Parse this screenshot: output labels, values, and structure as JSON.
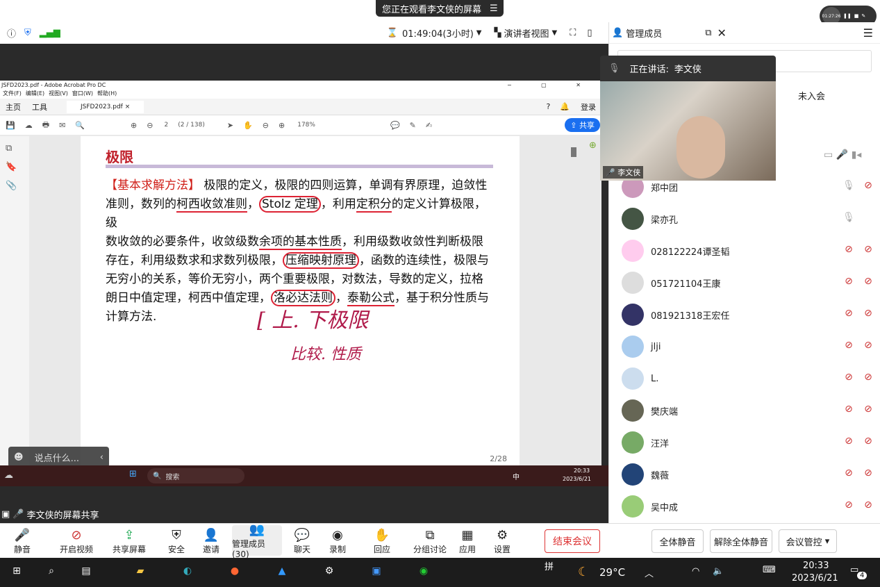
{
  "top": {
    "banner": "您正在观看李文侠的屏幕",
    "timer": "01:27:26"
  },
  "toolbar": {
    "duration": "01:49:04(3小时)",
    "view": "演讲者视图"
  },
  "panel": {
    "title": "管理成员",
    "not_joined": "未入会",
    "speaking_label": "正在讲话:",
    "speaking_name": "李文侠",
    "video_name": "李文侠",
    "members": [
      {
        "name": "郑中团",
        "mic": "on"
      },
      {
        "name": "梁亦孔",
        "mic": "on"
      },
      {
        "name": "028122224谭圣韬",
        "mic": "off"
      },
      {
        "name": "051721104王康",
        "mic": "off"
      },
      {
        "name": "081921318王宏任",
        "mic": "off"
      },
      {
        "name": "jlji",
        "mic": "off"
      },
      {
        "name": "L.",
        "mic": "off"
      },
      {
        "name": "樊庆端",
        "mic": "off"
      },
      {
        "name": "汪洋",
        "mic": "off"
      },
      {
        "name": "魏薇",
        "mic": "off"
      },
      {
        "name": "吴中成",
        "mic": "off"
      }
    ],
    "mute_all": "全体静音",
    "unmute_all": "解除全体静音",
    "control": "会议管控"
  },
  "acrobat": {
    "title": "JSFD2023.pdf - Adobe Acrobat Pro DC",
    "menu": [
      "文件(F)",
      "编辑(E)",
      "视图(V)",
      "窗口(W)",
      "帮助(H)"
    ],
    "tab_home": "主页",
    "tab_tools": "工具",
    "file_tab": "JSFD2023.pdf",
    "page": "2",
    "page_total": "(2 / 138)",
    "zoom": "178%",
    "share": "共享",
    "login": "登录",
    "page_indicator": "2/28"
  },
  "doc": {
    "heading": "极限",
    "tag": "【基本求解方法】",
    "l1": "极限的定义，极限的四则运算，单调有界原理，迫敛性",
    "l2a": "准则，数列的",
    "l2b": "柯西收敛准则",
    "l2c": "，",
    "l2d": "Stolz 定理",
    "l2e": "，利用",
    "l2f": "定积分",
    "l2g": "的定义计算极限，级",
    "l3a": "数收敛的必要条件，收敛级数",
    "l3b": "余项的基本性质",
    "l3c": "，利用级数收敛性判断极限",
    "l4a": "存在，利用级数求和求数列极限，",
    "l4b": "压缩映射原理",
    "l4c": "，函数的连续性，极限与",
    "l5": "无穷小的关系，等价无穷小，两个重要极限，对数法，导数的定义，拉格",
    "l6a": "朗日中值定理，柯西中值定理，",
    "l6b": "洛必达法则",
    "l6c": "，",
    "l6d": "泰勒公式",
    "l6e": "，基于积分性质与",
    "l7": "计算方法.",
    "hw1": "[ 上. 下极限",
    "hw2": "比较. 性质"
  },
  "chat": {
    "placeholder": "说点什么..."
  },
  "inner_taskbar": {
    "search": "搜索",
    "time": "20:33",
    "date": "2023/6/21",
    "lang": "中"
  },
  "share_label": "李文侠的屏幕共享",
  "bottom": {
    "mute": "静音",
    "video": "开启视频",
    "share": "共享屏幕",
    "security": "安全",
    "invite": "邀请",
    "members": "管理成员(30)",
    "chat": "聊天",
    "record": "录制",
    "reaction": "回应",
    "breakout": "分组讨论",
    "apps": "应用",
    "settings": "设置",
    "end": "结束会议"
  },
  "win": {
    "temp": "29°C",
    "time": "20:33",
    "date": "2023/6/21",
    "ime": "拼",
    "notif": "4"
  }
}
